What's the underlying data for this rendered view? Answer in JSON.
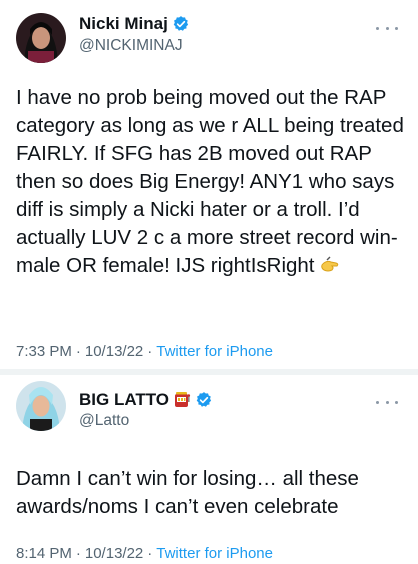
{
  "tweets": [
    {
      "author_name": "Nicki Minaj",
      "handle": "@NICKIMINAJ",
      "text": "I have no prob being moved out the RAP category as long as we r ALL being treated FAIRLY. If SFG has 2B moved out RAP then so does Big Energy! ANY1 who says diff is simply a Nicki hater or a troll. I’d actually LUV 2 c a more street record win- male OR female! IJS rightIsRight",
      "text_emoji": "pinching-hand-emoji",
      "time": "7:33 PM",
      "date": "10/13/22",
      "source": "Twitter for iPhone",
      "verified": true
    },
    {
      "author_name": "BIG LATTO",
      "name_emoji": "slot-machine-emoji",
      "handle": "@Latto",
      "text": "Damn I can’t win for losing… all these awards/noms I can’t even celebrate",
      "time": "8:14 PM",
      "date": "10/13/22",
      "source": "Twitter for iPhone",
      "verified": true
    }
  ],
  "colors": {
    "verified_blue": "#1d9bf0",
    "secondary_text": "#536471",
    "divider": "#eff3f4"
  },
  "separator": "·"
}
